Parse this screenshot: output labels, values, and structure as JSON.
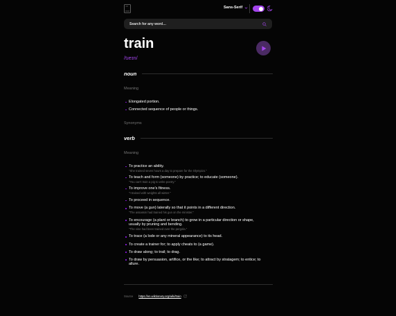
{
  "header": {
    "font_label": "Sans-Serif",
    "theme_toggle": "on",
    "accent": "#a445ed"
  },
  "search": {
    "placeholder": "Search for any word…",
    "value": ""
  },
  "entry": {
    "word": "train",
    "phonetic": "/tɹeɪn/",
    "meanings": [
      {
        "part_of_speech": "noun",
        "meaning_label": "Meaning",
        "definitions": [
          {
            "text": "Elongated portion.",
            "example": ""
          },
          {
            "text": "Connected sequence of people or things.",
            "example": ""
          }
        ],
        "synonyms_label": "Synonyms"
      },
      {
        "part_of_speech": "verb",
        "meaning_label": "Meaning",
        "definitions": [
          {
            "text": "To practice an ability.",
            "example": "\"She trained seven hours a day to prepare for the Olympics.\""
          },
          {
            "text": "To teach and form (someone) by practice; to educate (someone).",
            "example": "\"You can't train a pig to write poetry.\""
          },
          {
            "text": "To improve one's fitness.",
            "example": "\"I trained with weights all winter.\""
          },
          {
            "text": "To proceed in sequence.",
            "example": ""
          },
          {
            "text": "To move (a gun) laterally so that it points in a different direction.",
            "example": "\"The assassin had trained his gun on the minister.\""
          },
          {
            "text": "To encourage (a plant or branch) to grow in a particular direction or shape, usually by pruning and bending.",
            "example": "\"The vine had been trained over the pergola.\""
          },
          {
            "text": "To trace (a lode or any mineral appearance) to its head.",
            "example": ""
          },
          {
            "text": "To create a trainer for; to apply cheats to (a game).",
            "example": ""
          },
          {
            "text": "To draw along; to trail; to drag.",
            "example": ""
          },
          {
            "text": "To draw by persuasion, artifice, or the like; to attract by stratagem; to entice; to allure.",
            "example": ""
          }
        ]
      }
    ]
  },
  "source": {
    "label": "Source",
    "url": "https://en.wiktionary.org/wiki/train"
  }
}
